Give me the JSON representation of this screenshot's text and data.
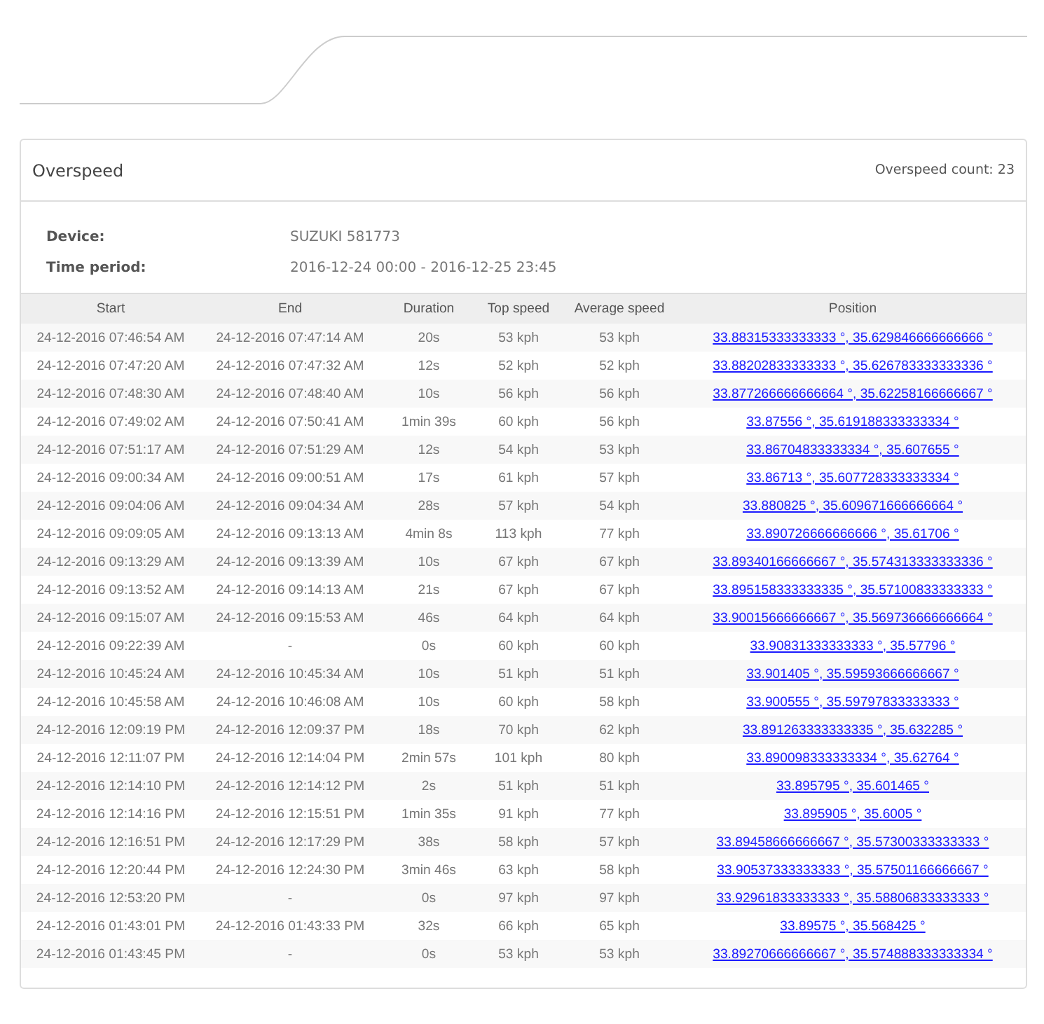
{
  "panel": {
    "title": "Overspeed",
    "count": "Overspeed count: 23"
  },
  "info": [
    {
      "label": "Device:",
      "value": "SUZUKI 581773"
    },
    {
      "label": "Time period:",
      "value": "2016-12-24 00:00 - 2016-12-25 23:45"
    }
  ],
  "table": {
    "columns": [
      "Start",
      "End",
      "Duration",
      "Top speed",
      "Average speed",
      "Position"
    ],
    "rows": [
      [
        "24-12-2016 07:46:54 AM",
        "24-12-2016 07:47:14 AM",
        "20s",
        "53 kph",
        "53 kph",
        "33.88315333333333 °, 35.629846666666666 °"
      ],
      [
        "24-12-2016 07:47:20 AM",
        "24-12-2016 07:47:32 AM",
        "12s",
        "52 kph",
        "52 kph",
        "33.88202833333333 °, 35.626783333333336 °"
      ],
      [
        "24-12-2016 07:48:30 AM",
        "24-12-2016 07:48:40 AM",
        "10s",
        "56 kph",
        "56 kph",
        "33.877266666666664 °, 35.62258166666667 °"
      ],
      [
        "24-12-2016 07:49:02 AM",
        "24-12-2016 07:50:41 AM",
        "1min 39s",
        "60 kph",
        "56 kph",
        "33.87556 °, 35.619188333333334 °"
      ],
      [
        "24-12-2016 07:51:17 AM",
        "24-12-2016 07:51:29 AM",
        "12s",
        "54 kph",
        "53 kph",
        "33.86704833333334 °, 35.607655 °"
      ],
      [
        "24-12-2016 09:00:34 AM",
        "24-12-2016 09:00:51 AM",
        "17s",
        "61 kph",
        "57 kph",
        "33.86713 °, 35.607728333333334 °"
      ],
      [
        "24-12-2016 09:04:06 AM",
        "24-12-2016 09:04:34 AM",
        "28s",
        "57 kph",
        "54 kph",
        "33.880825 °, 35.609671666666664 °"
      ],
      [
        "24-12-2016 09:09:05 AM",
        "24-12-2016 09:13:13 AM",
        "4min 8s",
        "113 kph",
        "77 kph",
        "33.890726666666666 °, 35.61706 °"
      ],
      [
        "24-12-2016 09:13:29 AM",
        "24-12-2016 09:13:39 AM",
        "10s",
        "67 kph",
        "67 kph",
        "33.89340166666667 °, 35.574313333333336 °"
      ],
      [
        "24-12-2016 09:13:52 AM",
        "24-12-2016 09:14:13 AM",
        "21s",
        "67 kph",
        "67 kph",
        "33.895158333333335 °, 35.57100833333333 °"
      ],
      [
        "24-12-2016 09:15:07 AM",
        "24-12-2016 09:15:53 AM",
        "46s",
        "64 kph",
        "64 kph",
        "33.90015666666667 °, 35.569736666666664 °"
      ],
      [
        "24-12-2016 09:22:39 AM",
        "-",
        "0s",
        "60 kph",
        "60 kph",
        "33.90831333333333 °, 35.57796 °"
      ],
      [
        "24-12-2016 10:45:24 AM",
        "24-12-2016 10:45:34 AM",
        "10s",
        "51 kph",
        "51 kph",
        "33.901405 °, 35.59593666666667 °"
      ],
      [
        "24-12-2016 10:45:58 AM",
        "24-12-2016 10:46:08 AM",
        "10s",
        "60 kph",
        "58 kph",
        "33.900555 °, 35.59797833333333 °"
      ],
      [
        "24-12-2016 12:09:19 PM",
        "24-12-2016 12:09:37 PM",
        "18s",
        "70 kph",
        "62 kph",
        "33.891263333333335 °, 35.632285 °"
      ],
      [
        "24-12-2016 12:11:07 PM",
        "24-12-2016 12:14:04 PM",
        "2min 57s",
        "101 kph",
        "80 kph",
        "33.890098333333334 °, 35.62764 °"
      ],
      [
        "24-12-2016 12:14:10 PM",
        "24-12-2016 12:14:12 PM",
        "2s",
        "51 kph",
        "51 kph",
        "33.895795 °, 35.601465 °"
      ],
      [
        "24-12-2016 12:14:16 PM",
        "24-12-2016 12:15:51 PM",
        "1min 35s",
        "91 kph",
        "77 kph",
        "33.895905 °, 35.6005 °"
      ],
      [
        "24-12-2016 12:16:51 PM",
        "24-12-2016 12:17:29 PM",
        "38s",
        "58 kph",
        "57 kph",
        "33.89458666666667 °, 35.57300333333333 °"
      ],
      [
        "24-12-2016 12:20:44 PM",
        "24-12-2016 12:24:30 PM",
        "3min 46s",
        "63 kph",
        "58 kph",
        "33.90537333333333 °, 35.57501166666667 °"
      ],
      [
        "24-12-2016 12:53:20 PM",
        "-",
        "0s",
        "97 kph",
        "97 kph",
        "33.92961833333333 °, 35.58806833333333 °"
      ],
      [
        "24-12-2016 01:43:01 PM",
        "24-12-2016 01:43:33 PM",
        "32s",
        "66 kph",
        "65 kph",
        "33.89575 °, 35.568425 °"
      ],
      [
        "24-12-2016 01:43:45 PM",
        "-",
        "0s",
        "53 kph",
        "53 kph",
        "33.89270666666667 °, 35.574888333333334 °"
      ]
    ]
  }
}
